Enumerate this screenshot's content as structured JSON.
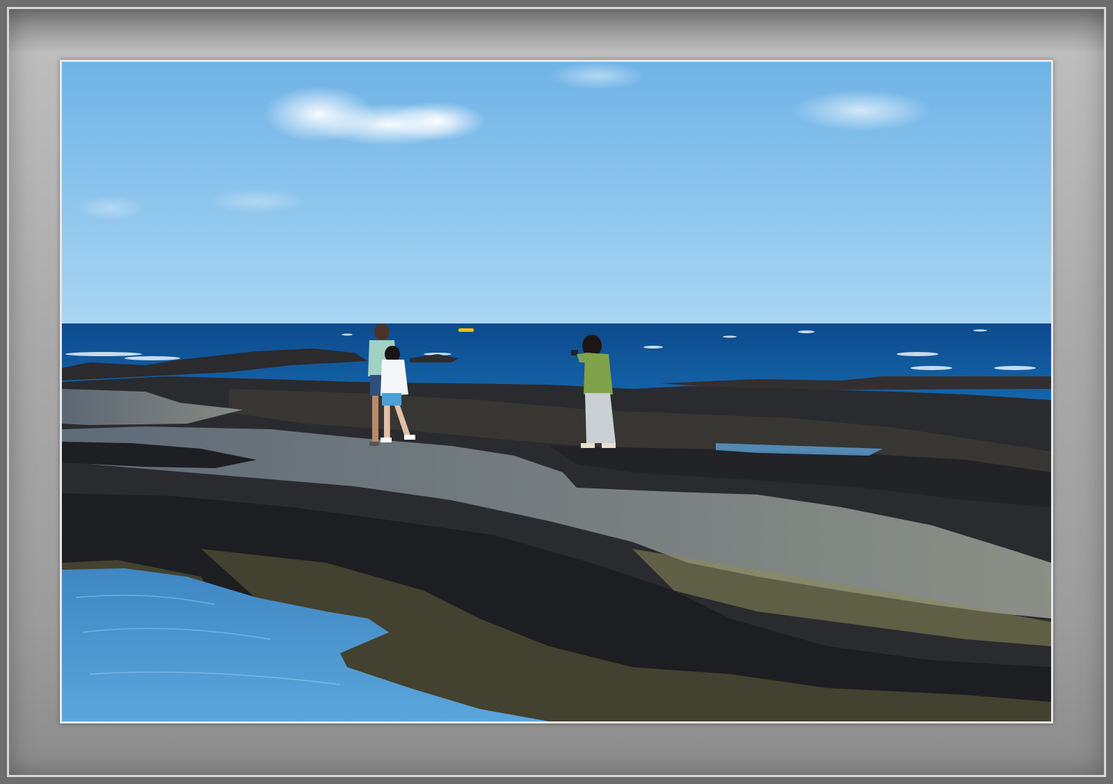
{
  "scene": {
    "colors": {
      "sky_top": "#7fbde9",
      "sky_bottom": "#a9d6f3",
      "sea_far": "#0f4f93",
      "sea_near": "#1b73b9",
      "rock_dark": "#2a2c30",
      "rock_mid": "#4a463f",
      "rock_moss": "#6d6a47",
      "tidepool": "#4a8fc9",
      "frame": "#9c9c9c"
    },
    "people": [
      {
        "label": "man",
        "shirt": "#9fd1c4",
        "shorts": "#2e4f7a"
      },
      {
        "label": "girl",
        "shirt": "#f4f6fa",
        "shorts": "#4aa0d8"
      },
      {
        "label": "woman-photographer",
        "jacket": "#7fa24a",
        "skirt": "#c9cfd2"
      }
    ]
  }
}
